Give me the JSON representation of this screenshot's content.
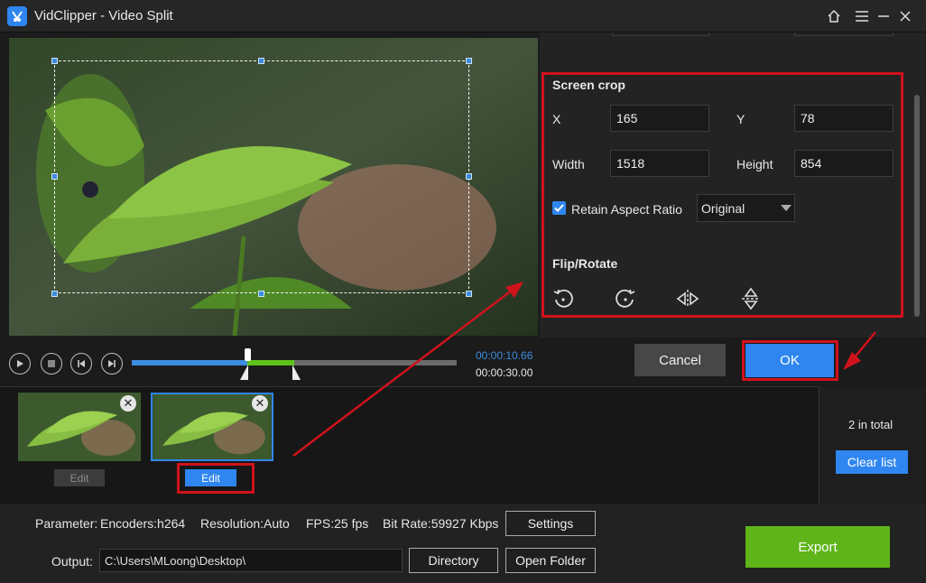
{
  "window": {
    "title": "VidClipper - Video Split"
  },
  "crop": {
    "section_title": "Screen crop",
    "x_label": "X",
    "x_value": "165",
    "y_label": "Y",
    "y_value": "78",
    "width_label": "Width",
    "width_value": "1518",
    "height_label": "Height",
    "height_value": "854",
    "retain_label": "Retain Aspect Ratio",
    "retain_checked": true,
    "ratio_value": "Original"
  },
  "flip": {
    "section_title": "Flip/Rotate"
  },
  "player": {
    "current_time": "00:00:10.66",
    "total_time": "00:00:30.00"
  },
  "dialog": {
    "cancel_label": "Cancel",
    "ok_label": "OK"
  },
  "clips": {
    "edit_label": "Edit",
    "total": "2 in total",
    "clear_label": "Clear list"
  },
  "parameters": {
    "param_label": "Parameter:",
    "encoder": "Encoders:h264",
    "resolution": "Resolution:Auto",
    "fps": "FPS:25 fps",
    "bitrate": "Bit Rate:59927 Kbps",
    "settings_label": "Settings"
  },
  "output": {
    "label": "Output:",
    "path": "C:\\Users\\MLoong\\Desktop\\",
    "directory_label": "Directory",
    "open_folder_label": "Open Folder"
  },
  "export_label": "Export",
  "colors": {
    "accent": "#2f86f0",
    "highlight": "#d0121c",
    "export": "#5fb519",
    "segment": "#5ec21a"
  }
}
